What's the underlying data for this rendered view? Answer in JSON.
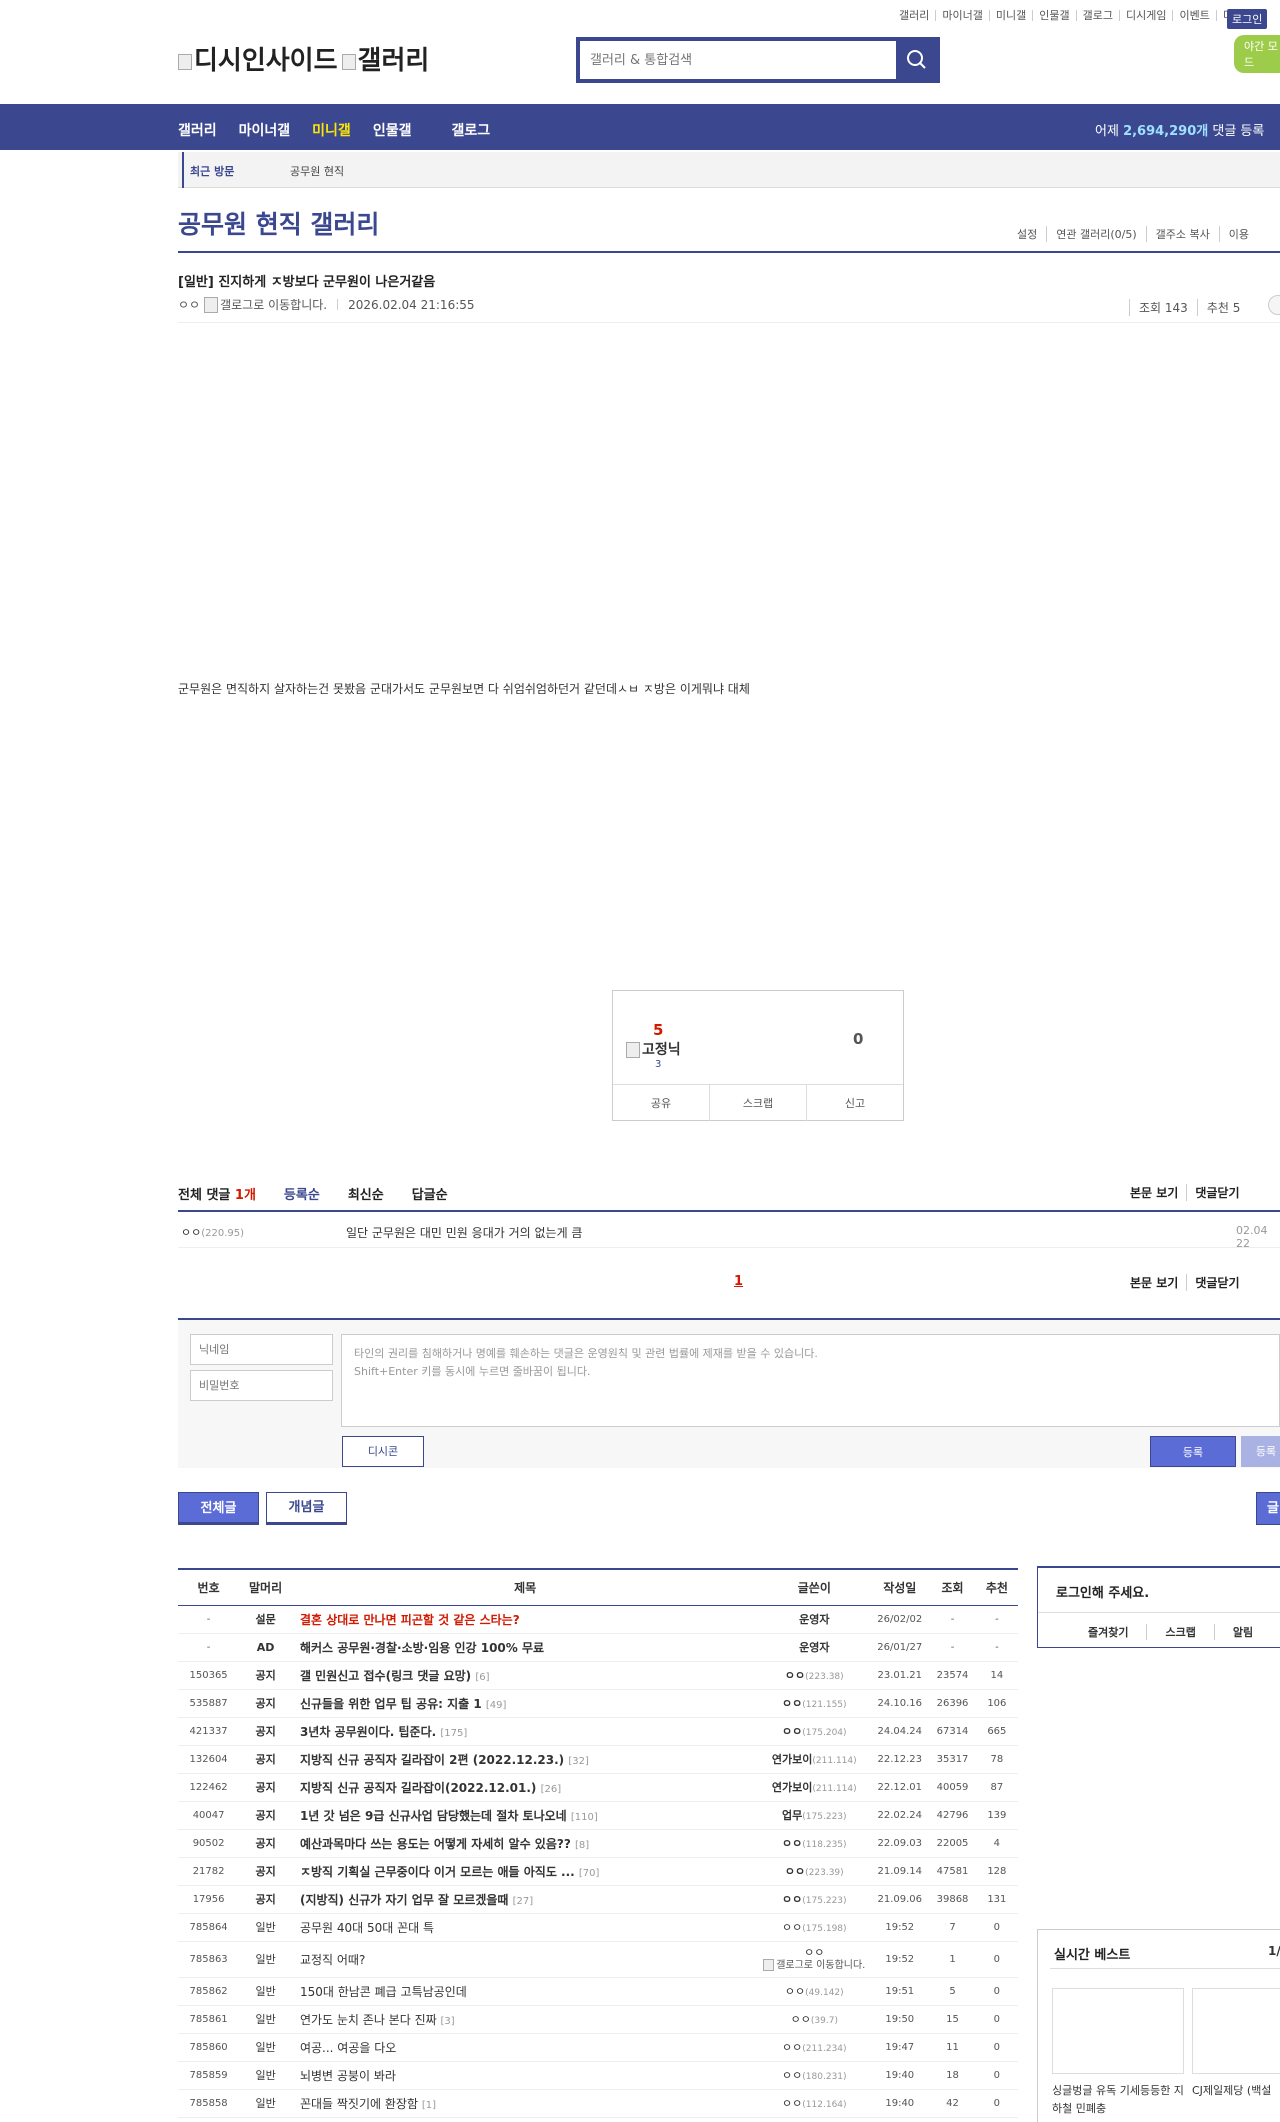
{
  "util": {
    "links": [
      "갤러리",
      "마이너갤",
      "미니갤",
      "인물갤",
      "갤로그",
      "디시게임",
      "이벤트",
      "디시콘"
    ],
    "login": "로그인",
    "night": "야간 모드"
  },
  "logo": {
    "site": "디시인사이드",
    "gallery": "갤러리"
  },
  "search": {
    "placeholder": "갤러리 & 통합검색"
  },
  "nav": {
    "items": [
      "갤러리",
      "마이너갤",
      "미니갤",
      "인물갤",
      "갤로그"
    ],
    "stat_prefix": "어제",
    "stat_value": "2,694,290개",
    "stat_suffix": "댓글 등록"
  },
  "visit": {
    "label": "최근 방문",
    "item": "공무원 현직"
  },
  "gallery": {
    "title": "공무원 현직 갤러리",
    "links": [
      "설정",
      "연관 갤러리(0/5)",
      "갤주소 복사",
      "이용"
    ]
  },
  "post": {
    "title": "[일반] 진지하게 ㅈ방보다 군무원이 나은거같음",
    "author": "ㅇㅇ",
    "gallog_alt": "갤로그로 이동합니다.",
    "date": "2026.02.04 21:16:55",
    "views": "조회 143",
    "recommend": "추천 5",
    "body": "군무원은 면직하지 살자하는건 못봤음 군대가서도 군무원보면 다 쉬엄쉬엄하던거 같던데ㅅㅂ ㅈ방은 이게뭐냐 대체"
  },
  "recommend_box": {
    "up": "5",
    "fix_label": "고정닉",
    "fix_count": "3",
    "down": "0",
    "actions": [
      "공유",
      "스크랩",
      "신고"
    ]
  },
  "comments": {
    "total_label": "전체 댓글",
    "total_count": "1개",
    "sort_tabs": [
      "등록순",
      "최신순",
      "답글순"
    ],
    "right_links": [
      "본문 보기",
      "댓글닫기"
    ],
    "items": [
      {
        "name": "ㅇㅇ",
        "ip": "(220.95)",
        "text": "일단 군무원은 대민 민원 응대가 거의 없는게 큼",
        "date": "02.04 22"
      }
    ],
    "page": "1"
  },
  "write": {
    "nick_placeholder": "닉네임",
    "pw_placeholder": "비밀번호",
    "text_placeholder_1": "타인의 권리를 침해하거나 명예를 훼손하는 댓글은 운영원칙 및 관련 법률에 제재를 받을 수 있습니다.",
    "text_placeholder_2": "Shift+Enter 키를 동시에 누르면 줄바꿈이 됩니다.",
    "dccon": "디시콘",
    "submit": "등록",
    "submit2": "등록"
  },
  "list_tabs": {
    "all": "전체글",
    "concept": "개념글",
    "write": "글"
  },
  "list": {
    "headers": [
      "번호",
      "말머리",
      "제목",
      "글쓴이",
      "작성일",
      "조회",
      "추천"
    ],
    "rows": [
      {
        "num": "-",
        "head": "설문",
        "title": "결혼 상대로 만나면 피곤할 것 같은 스타는?",
        "rc": "",
        "writer": "운영자",
        "ip": "",
        "date": "26/02/02",
        "views": "-",
        "rec": "-",
        "type": "survey"
      },
      {
        "num": "-",
        "head": "AD",
        "title": "해커스 공무원·경찰·소방·임용 인강 100% 무료",
        "rc": "",
        "writer": "운영자",
        "ip": "",
        "date": "26/01/27",
        "views": "-",
        "rec": "-",
        "type": "notice"
      },
      {
        "num": "150365",
        "head": "공지",
        "title": "갤 민원신고 접수(링크 댓글 요망)",
        "rc": "[6]",
        "writer": "ㅇㅇ",
        "ip": "(223.38)",
        "date": "23.01.21",
        "views": "23574",
        "rec": "14",
        "type": "notice"
      },
      {
        "num": "535887",
        "head": "공지",
        "title": "신규들을 위한 업무 팁 공유: 지출 1",
        "rc": "[49]",
        "writer": "ㅇㅇ",
        "ip": "(121.155)",
        "date": "24.10.16",
        "views": "26396",
        "rec": "106",
        "type": "notice"
      },
      {
        "num": "421337",
        "head": "공지",
        "title": "3년차 공무원이다. 팁준다.",
        "rc": "[175]",
        "writer": "ㅇㅇ",
        "ip": "(175.204)",
        "date": "24.04.24",
        "views": "67314",
        "rec": "665",
        "type": "notice"
      },
      {
        "num": "132604",
        "head": "공지",
        "title": "지방직 신규 공직자 길라잡이 2편 (2022.12.23.)",
        "rc": "[32]",
        "writer": "연가보이",
        "ip": "(211.114)",
        "date": "22.12.23",
        "views": "35317",
        "rec": "78",
        "type": "notice"
      },
      {
        "num": "122462",
        "head": "공지",
        "title": "지방직 신규 공직자 길라잡이(2022.12.01.)",
        "rc": "[26]",
        "writer": "연가보이",
        "ip": "(211.114)",
        "date": "22.12.01",
        "views": "40059",
        "rec": "87",
        "type": "notice"
      },
      {
        "num": "40047",
        "head": "공지",
        "title": "1년 갓 넘은 9급 신규사업 담당했는데 절차 토나오네",
        "rc": "[110]",
        "writer": "업무",
        "ip": "(175.223)",
        "date": "22.02.24",
        "views": "42796",
        "rec": "139",
        "type": "notice"
      },
      {
        "num": "90502",
        "head": "공지",
        "title": "예산과목마다 쓰는 용도는 어떻게 자세히 알수 있음??",
        "rc": "[8]",
        "writer": "ㅇㅇ",
        "ip": "(118.235)",
        "date": "22.09.03",
        "views": "22005",
        "rec": "4",
        "type": "notice"
      },
      {
        "num": "21782",
        "head": "공지",
        "title": "ㅈ방직 기획실 근무중이다 이거 모르는 애들 아직도 ...",
        "rc": "[70]",
        "writer": "ㅇㅇ",
        "ip": "(223.39)",
        "date": "21.09.14",
        "views": "47581",
        "rec": "128",
        "type": "notice"
      },
      {
        "num": "17956",
        "head": "공지",
        "title": "(지방직) 신규가 자기 업무 잘 모르겠을때",
        "rc": "[27]",
        "writer": "ㅇㅇ",
        "ip": "(175.223)",
        "date": "21.09.06",
        "views": "39868",
        "rec": "131",
        "type": "notice"
      },
      {
        "num": "785864",
        "head": "일반",
        "title": "공무원 40대 50대 꼰대 특",
        "rc": "",
        "writer": "ㅇㅇ",
        "ip": "(175.198)",
        "date": "19:52",
        "views": "7",
        "rec": "0",
        "type": "normal"
      },
      {
        "num": "785863",
        "head": "일반",
        "title": "교정직 어때?",
        "rc": "",
        "writer": "ㅇㅇ",
        "ip": "",
        "date": "19:52",
        "views": "1",
        "rec": "0",
        "type": "gallog"
      },
      {
        "num": "785862",
        "head": "일반",
        "title": "150대 한남콘 폐급 고특남공인데",
        "rc": "",
        "writer": "ㅇㅇ",
        "ip": "(49.142)",
        "date": "19:51",
        "views": "5",
        "rec": "0",
        "type": "normal"
      },
      {
        "num": "785861",
        "head": "일반",
        "title": "연가도 눈치 존나 본다 진짜",
        "rc": "[3]",
        "writer": "ㅇㅇ",
        "ip": "(39.7)",
        "date": "19:50",
        "views": "15",
        "rec": "0",
        "type": "normal"
      },
      {
        "num": "785860",
        "head": "일반",
        "title": "여공... 여공을 다오",
        "rc": "",
        "writer": "ㅇㅇ",
        "ip": "(211.234)",
        "date": "19:47",
        "views": "11",
        "rec": "0",
        "type": "normal"
      },
      {
        "num": "785859",
        "head": "일반",
        "title": "뇌병변 공붕이 봐라",
        "rc": "",
        "writer": "ㅇㅇ",
        "ip": "(180.231)",
        "date": "19:40",
        "views": "18",
        "rec": "0",
        "type": "normal"
      },
      {
        "num": "785858",
        "head": "일반",
        "title": "꼰대들 짝짓기에 환장함",
        "rc": "[1]",
        "writer": "ㅇㅇ",
        "ip": "(112.164)",
        "date": "19:40",
        "views": "42",
        "rec": "0",
        "type": "normal"
      }
    ]
  },
  "side": {
    "login_msg": "로그인해 주세요.",
    "login_links": [
      "즐겨찾기",
      "스크랩",
      "알림"
    ],
    "best_title": "실시간 베스트",
    "best_page": "1/",
    "best_items": [
      "싱글벙글 유독 기세등등한 지하철 민폐충",
      "CJ제일제당 (백설"
    ]
  },
  "colors": {
    "brand": "#3b4890",
    "accent_red": "#d31900",
    "nav_active": "#fde700"
  }
}
